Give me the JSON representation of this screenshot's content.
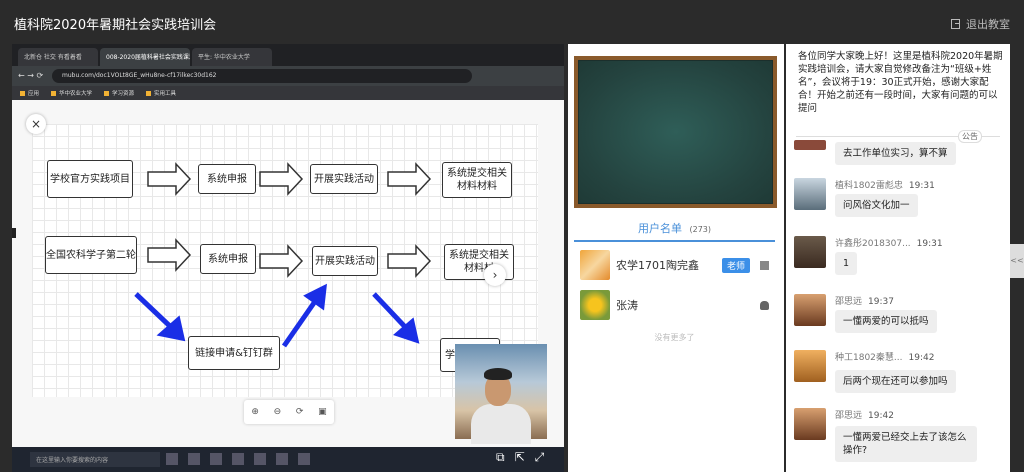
{
  "header": {
    "title": "植科院2020年暑期社会实践培训会",
    "logout_label": "退出教室"
  },
  "browser": {
    "tabs": [
      "北新仓 社交 有看着看",
      "008-2020届植科暑社会实践课汇二",
      "平生: 华中农业大学"
    ],
    "address": "mubu.com/doc1VOLt8GE_wHu8ne-cf17ilkec30d162",
    "bookmarks": [
      "应用",
      "华中农业大学",
      "学习资源",
      "实用工具"
    ]
  },
  "diagram": {
    "row1": [
      "学校官方实践项目",
      "系统申报",
      "开展实践活动",
      "系统提交相关材料材料"
    ],
    "row2": [
      "全国农科学子第二轮",
      "系统申报",
      "开展实践活动",
      "系统提交相关材料材"
    ],
    "row3": [
      "链接申请&钉钉群",
      "学院汇总相关材料"
    ]
  },
  "taskbar": {
    "search_placeholder": "在这里输入你要搜索的内容"
  },
  "users": {
    "tab_label": "用户名单",
    "count": "(273)",
    "list": [
      {
        "name": "农学1701陶完鑫",
        "tag": "老师",
        "os": "windows"
      },
      {
        "name": "张涛",
        "tag": "",
        "os": "android"
      }
    ],
    "no_more": "没有更多了"
  },
  "chat": {
    "notice": "各位同学大家晚上好！这里是植科院2020年暑期实践培训会，请大家自觉修改备注为“班级+姓名”，会议将于19：30正式开始，感谢大家配合！开始之前还有一段时间，大家有问题的可以提问",
    "notice_tag": "公告",
    "messages": [
      {
        "name": "",
        "time": "",
        "text": "去工作单位实习，算不算"
      },
      {
        "name": "植科1802雷彪忠",
        "time": "19:31",
        "text": "问风俗文化加一"
      },
      {
        "name": "许鑫彤2018307...",
        "time": "19:31",
        "text": "1"
      },
      {
        "name": "邵思远",
        "time": "19:37",
        "text": "一懂两爱的可以抵吗"
      },
      {
        "name": "种工1802秦慧...",
        "time": "19:42",
        "text": "后两个现在还可以参加吗"
      },
      {
        "name": "邵思远",
        "time": "19:42",
        "text": "一懂两爱已经交上去了该怎么操作?"
      }
    ]
  },
  "colors": {
    "accent": "#4a90d9",
    "teacher_tag": "#3b8fe8",
    "arrow_blue": "#1a2ee6",
    "board_green": "#2f5e58"
  },
  "icons": {
    "logout": "door-icon",
    "close": "close-icon",
    "next": "chevron-right-icon"
  }
}
